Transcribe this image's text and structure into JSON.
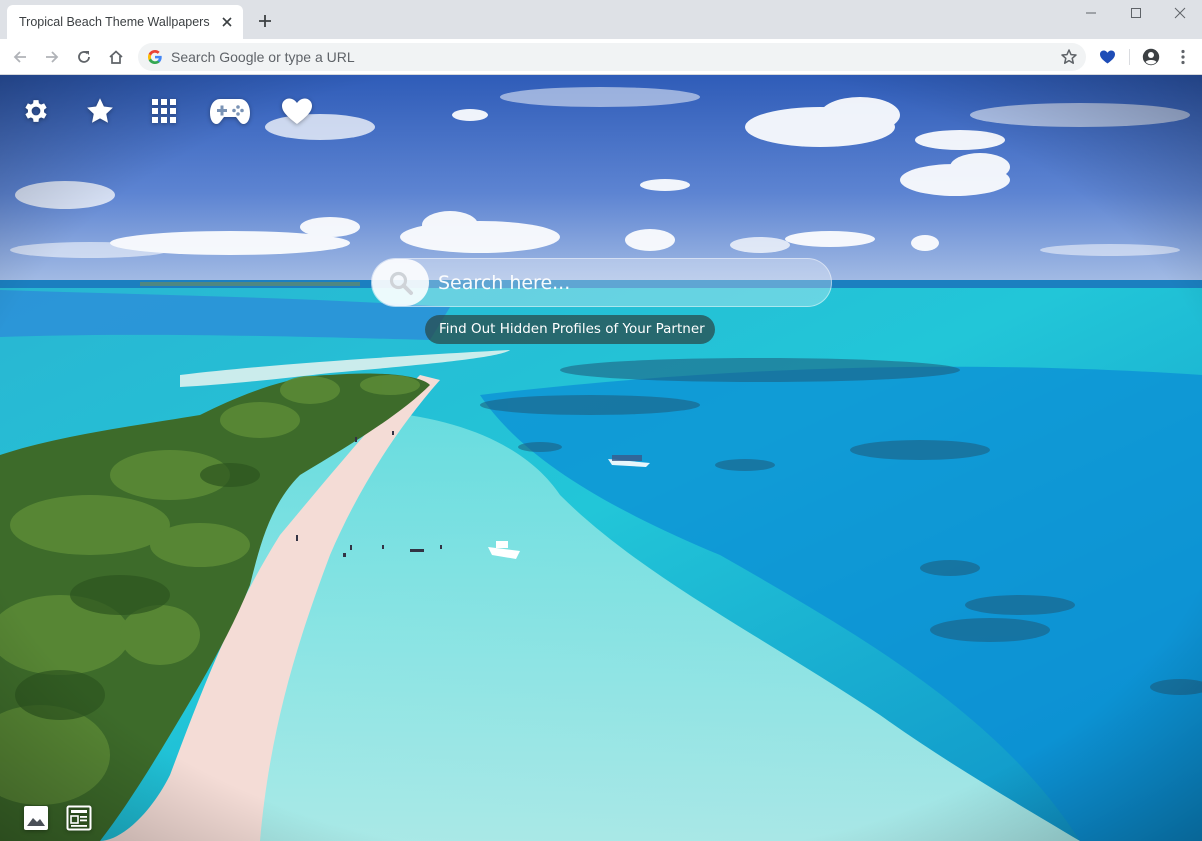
{
  "browser": {
    "tab": {
      "title": "Tropical Beach Theme Wallpapers",
      "close_icon": "close-icon"
    },
    "new_tab_icon": "plus-icon",
    "window_controls": [
      "minimize-icon",
      "maximize-icon",
      "close-icon"
    ],
    "toolbar": {
      "back_icon": "arrow-left-icon",
      "forward_icon": "arrow-right-icon",
      "reload_icon": "reload-icon",
      "home_icon": "home-icon",
      "omnibox_placeholder": "Search Google or type a URL",
      "bookmark_icon": "star-outline-icon",
      "extension_icon": "heart-icon",
      "profile_icon": "account-circle-icon",
      "menu_icon": "kebab-menu-icon"
    },
    "accent_color": "#1a73e8",
    "extension_color": "#1e4db7"
  },
  "page": {
    "top_icons": [
      "gear-icon",
      "star-icon",
      "apps-grid-icon",
      "gamepad-icon",
      "heart-icon"
    ],
    "search": {
      "placeholder": "Search here...",
      "button_icon": "search-icon"
    },
    "promo_link": "Find Out Hidden Profiles of Your Partner",
    "bottom_icons": [
      "image-icon",
      "news-icon"
    ],
    "wallpaper": {
      "subject": "tropical-beach-aerial",
      "sky_color": "#4a73c9",
      "water_color": "#28c7d6",
      "sand_color": "#f4dcd6"
    }
  }
}
